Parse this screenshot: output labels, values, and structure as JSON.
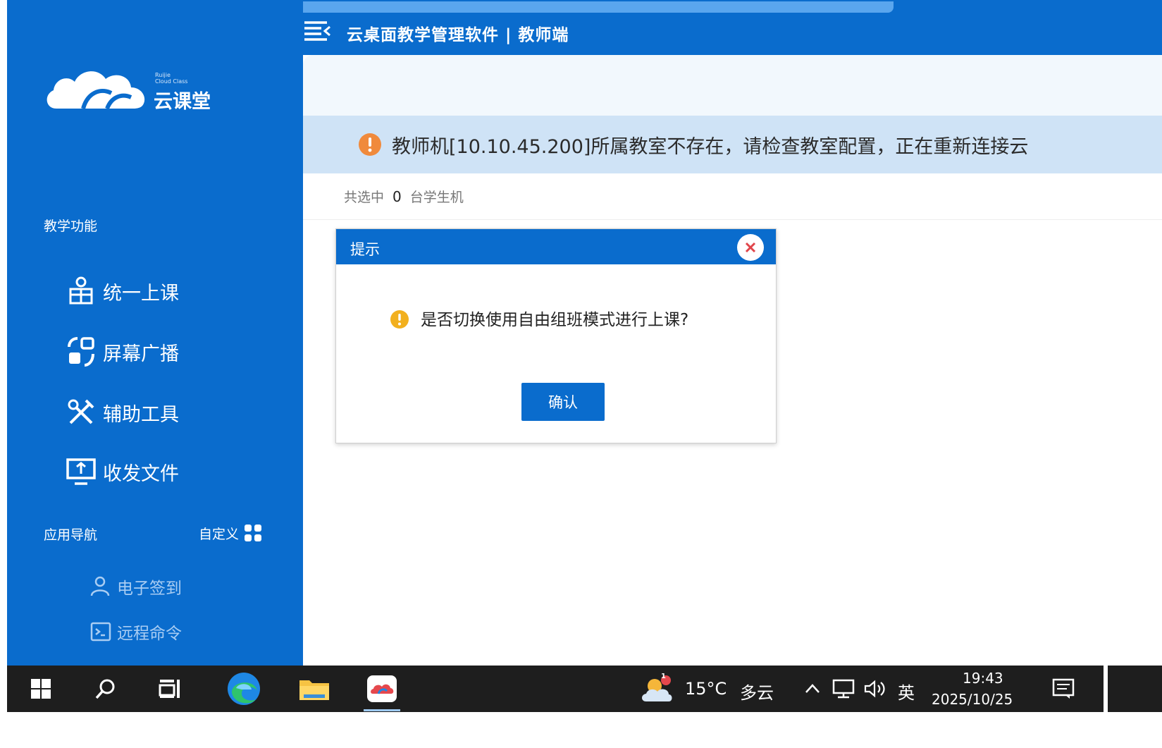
{
  "app": {
    "title": "云桌面教学管理软件 | 教师端",
    "logo_small_line1": "Ruijie",
    "logo_small_line2": "Cloud Class",
    "logo_text": "云课堂",
    "brand_color": "#0a6ccd"
  },
  "sidebar": {
    "section_teaching": "教学功能",
    "items": [
      {
        "label": "统一上课",
        "icon": "class-icon"
      },
      {
        "label": "屏幕广播",
        "icon": "broadcast-icon"
      },
      {
        "label": "辅助工具",
        "icon": "tools-icon"
      },
      {
        "label": "收发文件",
        "icon": "file-transfer-icon"
      }
    ],
    "section_apps": "应用导航",
    "customize_label": "自定义",
    "sub_items": [
      {
        "label": "电子签到",
        "icon": "sign-in-icon"
      },
      {
        "label": "远程命令",
        "icon": "terminal-icon"
      }
    ]
  },
  "alert": {
    "text": "教师机[10.10.45.200]所属教室不存在，请检查教室配置，正在重新连接云"
  },
  "selection": {
    "prefix": "共选中",
    "count": "0",
    "suffix": "台学生机"
  },
  "dialog": {
    "title": "提示",
    "message": "是否切换使用自由组班模式进行上课?",
    "confirm_label": "确认"
  },
  "taskbar": {
    "weather_temp": "15°C",
    "weather_desc": "多云",
    "weather_badge": "1",
    "input_lang": "英",
    "time": "19:43",
    "date": "2025/10/25"
  }
}
